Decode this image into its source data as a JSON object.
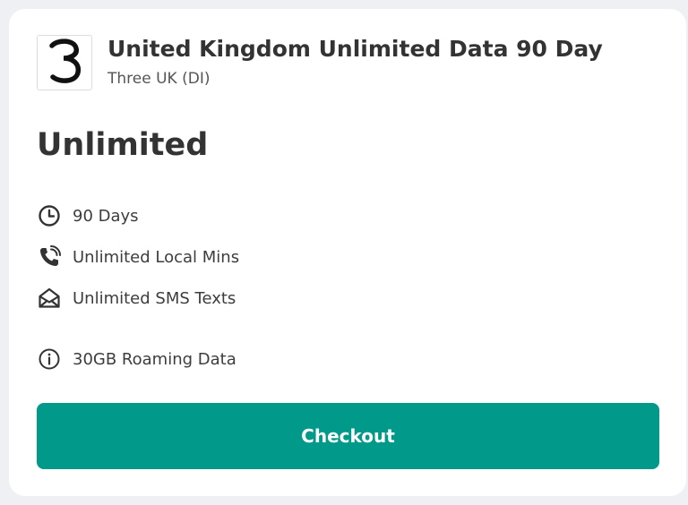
{
  "plan": {
    "title": "United Kingdom Unlimited Data 90 Day",
    "operator": "Three UK (DI)",
    "logo_icon": "three-3-logo-icon",
    "data_amount": "Unlimited"
  },
  "features": [
    {
      "icon": "clock-icon",
      "label": "90 Days"
    },
    {
      "icon": "phone-call-icon",
      "label": "Unlimited Local Mins"
    },
    {
      "icon": "envelope-open-icon",
      "label": "Unlimited SMS Texts"
    },
    {
      "icon": "info-circle-icon",
      "label": "30GB Roaming Data"
    }
  ],
  "actions": {
    "checkout_label": "Checkout"
  },
  "colors": {
    "accent": "#00998a",
    "text": "#333333"
  }
}
